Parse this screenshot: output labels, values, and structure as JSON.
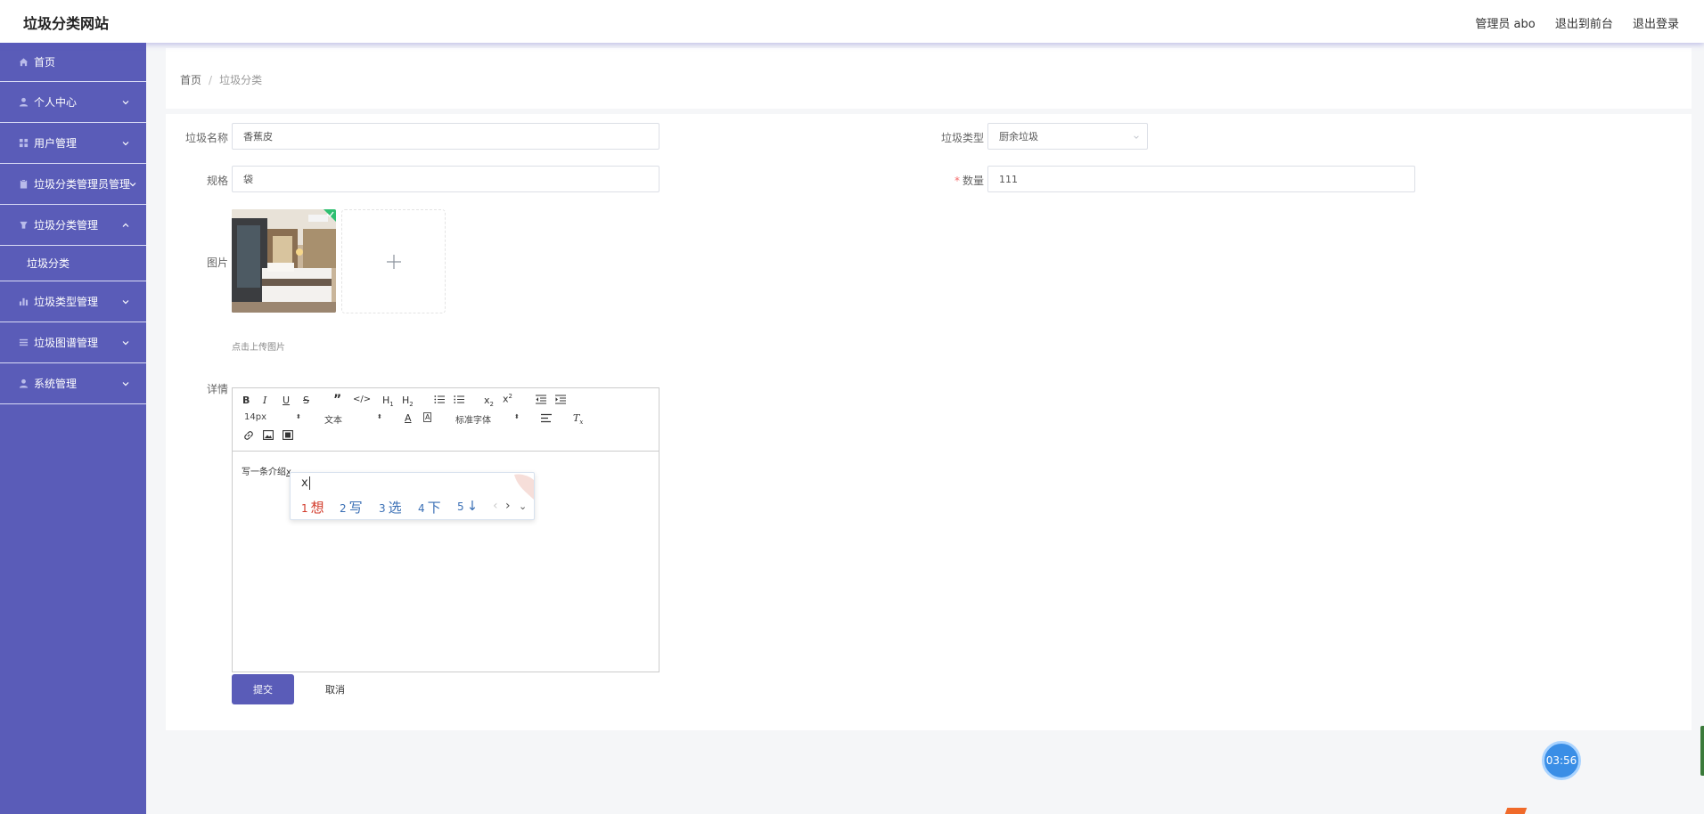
{
  "header": {
    "site_title": "垃圾分类网站",
    "admin": "管理员 abo",
    "to_front": "退出到前台",
    "logout": "退出登录"
  },
  "sidebar": {
    "items": [
      {
        "label": "首页",
        "icon": "home-icon"
      },
      {
        "label": "个人中心",
        "icon": "user-icon"
      },
      {
        "label": "用户管理",
        "icon": "grid-icon"
      },
      {
        "label": "垃圾分类管理员管理",
        "icon": "clipboard-icon"
      },
      {
        "label": "垃圾分类管理",
        "icon": "bin-icon",
        "expanded": true,
        "sub": [
          {
            "label": "垃圾分类"
          }
        ]
      },
      {
        "label": "垃圾类型管理",
        "icon": "bar-chart-icon"
      },
      {
        "label": "垃圾图谱管理",
        "icon": "list-icon"
      },
      {
        "label": "系统管理",
        "icon": "user-icon"
      }
    ],
    "color": "#5a5cb8"
  },
  "breadcrumb": {
    "home": "首页",
    "separator": "/",
    "current": "垃圾分类"
  },
  "form": {
    "name_label": "垃圾名称",
    "name_value": "香蕉皮",
    "type_label": "垃圾类型",
    "type_value": "厨余垃圾",
    "spec_label": "规格",
    "spec_value": "袋",
    "qty_label": "数量",
    "qty_required": "*",
    "qty_value": "111",
    "image_label": "图片",
    "upload_hint": "点击上传图片",
    "details_label": "详情",
    "submit": "提交",
    "cancel": "取消"
  },
  "editor": {
    "font_size": "14px",
    "block": "文本",
    "font": "标准字体",
    "content": "写一条介绍",
    "cursor_suffix": "x"
  },
  "ime": {
    "input": "x",
    "candidates": [
      {
        "n": "1",
        "text": "想"
      },
      {
        "n": "2",
        "text": "写"
      },
      {
        "n": "3",
        "text": "选"
      },
      {
        "n": "4",
        "text": "下"
      },
      {
        "n": "5",
        "text": "↓"
      }
    ]
  },
  "timer": "03:56",
  "accent_color": "#5a5cb8"
}
